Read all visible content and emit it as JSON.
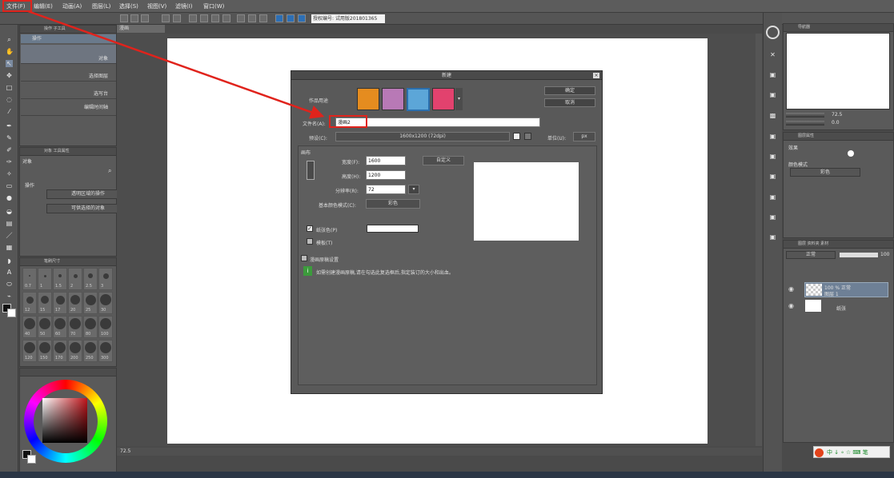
{
  "menu": [
    "文件(F)",
    "编辑(E)",
    "动画(A)",
    "图层(L)",
    "选择(S)",
    "视图(V)",
    "滤镜(I)",
    "窗口(W)"
  ],
  "toolbar": {
    "license": "授权编号: 试用版201801365"
  },
  "canvas_tab": {
    "title": "漫画"
  },
  "left": {
    "tool_tabs": "操作  子工具",
    "tool_group_header": "操作",
    "subtools": [
      "对象",
      "选择图层",
      "选写台",
      "编辑时间轴"
    ],
    "prop_tabs": "对象  工具属性",
    "prop_header": "对象",
    "op_label": "操作",
    "op_option1": "透明区域的操作",
    "op_option2": "可供选择的对象",
    "brush_header": "笔刷尺寸",
    "brush_sizes_top": [
      "0.7",
      "1",
      "1.5",
      "2",
      "2.5",
      "3"
    ],
    "brush_sizes_mid": [
      "12",
      "15",
      "17",
      "20",
      "25",
      "30"
    ],
    "brush_sizes_low": [
      "40",
      "50",
      "60",
      "70",
      "80",
      "100"
    ],
    "brush_sizes_bottom": [
      "120",
      "150",
      "170",
      "200",
      "250",
      "300"
    ]
  },
  "dialog": {
    "title": "新建",
    "purpose_label": "作品用途",
    "ok": "确定",
    "cancel": "取消",
    "filename_label": "文件名(A):",
    "filename_value": "漫画2",
    "preset_label": "预设(C):",
    "preset_value": "1600x1200 (72dpi)",
    "unit_label": "单位(U):",
    "unit_value": "px",
    "canvas_section": "画布",
    "width_label": "宽度(F):",
    "width_value": "1600",
    "height_label": "高度(H):",
    "height_value": "1200",
    "resolution_label": "分辨率(R):",
    "resolution_value": "72",
    "custom": "自定义",
    "color_mode_label": "基本颜色模式(C):",
    "color_mode_value": "彩色",
    "paper_color_label": "纸张色(P)",
    "template_label": "模板(T)",
    "manga_section": "漫画原稿设置",
    "hint": "如需创建漫画原稿,请在勾选此复选框后,指定装订的大小和出血。"
  },
  "right": {
    "navigator_tab": "导航器",
    "zoom_value": "72.5",
    "rotate_value": "0.0",
    "layer_prop_tab": "图层属性",
    "effect_label": "效果",
    "color_mode_label": "颜色模式",
    "color_mode_value": "彩色",
    "layer_tabs": "图层  资料夹  素材",
    "blend_mode": "正常",
    "opacity": "100",
    "layers": [
      {
        "line1": "100 % 正常",
        "line2": "图层 1"
      },
      {
        "line1": "",
        "line2": "纸张"
      }
    ]
  },
  "status": {
    "zoom": "72.5"
  },
  "ime": {
    "text": "中 ↓ ∘ ☆ ⌨ 笔"
  },
  "colors": {
    "accent_red": "#e0231c",
    "panel": "#5a5a5a",
    "dialog_bg": "#595959"
  }
}
